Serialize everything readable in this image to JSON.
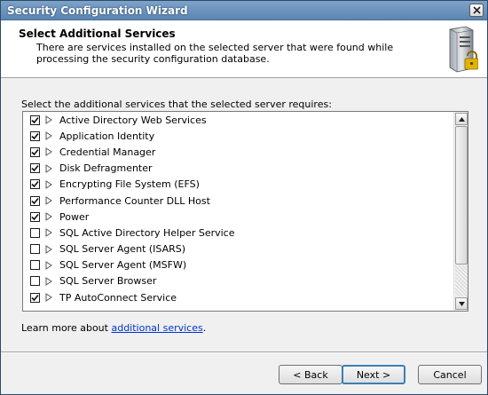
{
  "window": {
    "title": "Security Configuration Wizard"
  },
  "header": {
    "title": "Select Additional Services",
    "description": "There are services installed on the selected server that were found while processing the security configuration database."
  },
  "instruction": "Select the additional services that the selected server requires:",
  "services": [
    {
      "label": "Active Directory Web Services",
      "checked": true
    },
    {
      "label": "Application Identity",
      "checked": true
    },
    {
      "label": "Credential Manager",
      "checked": true
    },
    {
      "label": "Disk Defragmenter",
      "checked": true
    },
    {
      "label": "Encrypting File System (EFS)",
      "checked": true
    },
    {
      "label": "Performance Counter DLL Host",
      "checked": true
    },
    {
      "label": "Power",
      "checked": true
    },
    {
      "label": "SQL Active Directory Helper Service",
      "checked": false
    },
    {
      "label": "SQL Server Agent (ISARS)",
      "checked": false
    },
    {
      "label": "SQL Server Agent (MSFW)",
      "checked": false
    },
    {
      "label": "SQL Server Browser",
      "checked": false
    },
    {
      "label": "TP AutoConnect Service",
      "checked": true
    }
  ],
  "learn_more": {
    "prefix": "Learn more about ",
    "link": "additional services",
    "suffix": "."
  },
  "buttons": {
    "back": "< Back",
    "next": "Next >",
    "cancel": "Cancel"
  },
  "icons": {
    "header": "server-lock-icon",
    "close": "close-icon",
    "expander": "triangle-right-icon"
  },
  "colors": {
    "title_bar": "#5b85b1",
    "link": "#0033cc",
    "default_button_border": "#3c7fb1"
  }
}
